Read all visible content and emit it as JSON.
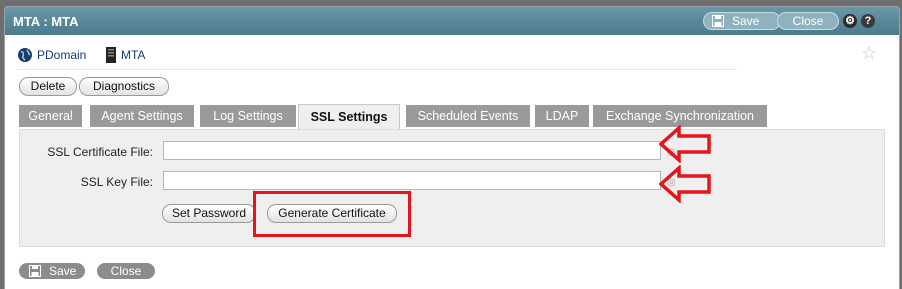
{
  "window": {
    "title": "MTA : MTA"
  },
  "titlebar": {
    "save_label": "Save",
    "close_label": "Close",
    "settings_icon": "gear-icon",
    "help_icon": "help-icon"
  },
  "breadcrumb": {
    "domain": "PDomain",
    "object": "MTA"
  },
  "actions": {
    "delete_label": "Delete",
    "diagnostics_label": "Diagnostics"
  },
  "tabs": [
    {
      "label": "General",
      "active": false
    },
    {
      "label": "Agent Settings",
      "active": false
    },
    {
      "label": "Log Settings",
      "active": false
    },
    {
      "label": "SSL Settings",
      "active": true
    },
    {
      "label": "Scheduled Events",
      "active": false
    },
    {
      "label": "LDAP",
      "active": false
    },
    {
      "label": "Exchange Synchronization",
      "active": false
    }
  ],
  "ssl": {
    "cert_label": "SSL Certificate File:",
    "cert_value": "",
    "key_label": "SSL Key File:",
    "key_value": "",
    "set_password_label": "Set Password",
    "generate_certificate_label": "Generate Certificate"
  },
  "footer": {
    "save_label": "Save",
    "close_label": "Close"
  },
  "colors": {
    "titlebar": "#5a889b",
    "tab_inactive": "#9a9a9a",
    "annotation_red": "#e6141b"
  }
}
